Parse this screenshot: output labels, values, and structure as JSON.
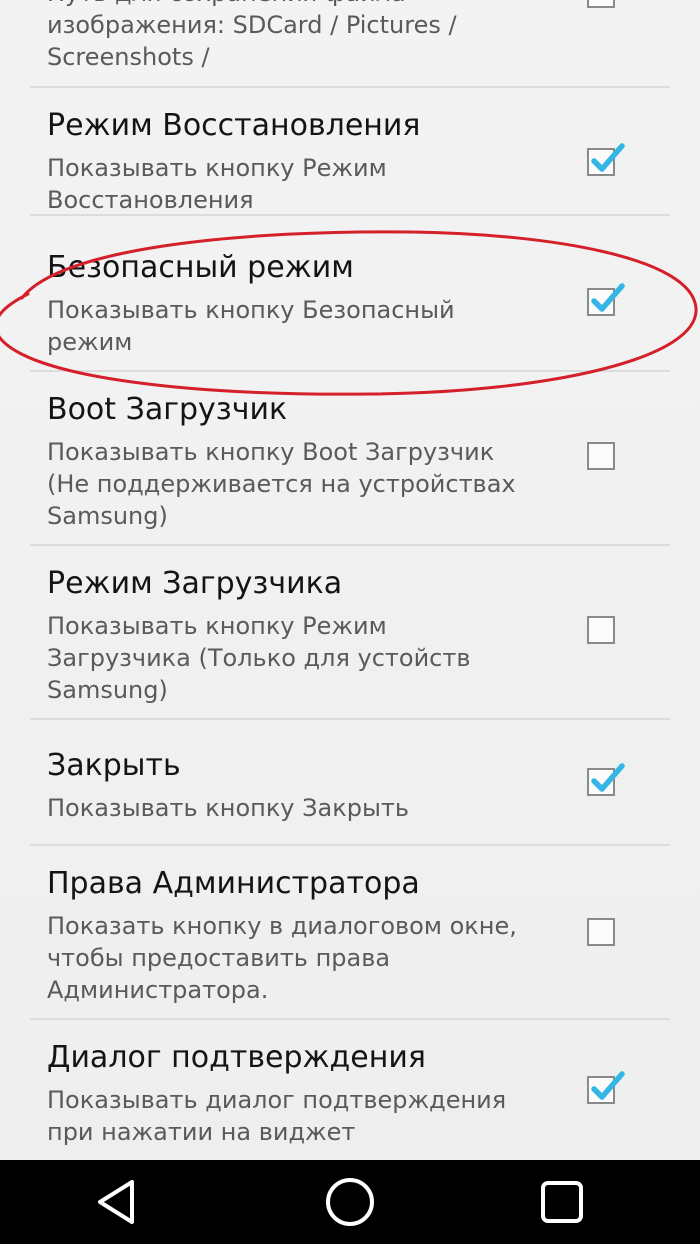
{
  "settings": {
    "items": [
      {
        "summary": "Путь для сохранения файла\nизображения: SDCard / Pictures /\nScreenshots /"
      },
      {
        "title": "Режим Восстановления",
        "summary": "Показывать кнопку Режим\nВосстановления",
        "checked": true
      },
      {
        "title": "Безопасный режим",
        "summary": "Показывать кнопку Безопасный\nрежим",
        "checked": true
      },
      {
        "title": "Boot Загрузчик",
        "summary": "Показывать кнопку Boot Загрузчик\n(Не поддерживается на устройствах\nSamsung)",
        "checked": false
      },
      {
        "title": "Режим Загрузчика",
        "summary": "Показывать кнопку Режим\nЗагрузчика (Только для устойств\nSamsung)",
        "checked": false
      },
      {
        "title": "Закрыть",
        "summary": "Показывать кнопку Закрыть",
        "checked": true
      },
      {
        "title": "Права Администратора",
        "summary": "Показать кнопку в диалоговом окне,\nчтобы предоставить права\nАдминистратора.",
        "checked": false
      },
      {
        "title": "Диалог подтверждения",
        "summary": "Показывать диалог подтверждения\nпри нажатии на виджет",
        "checked": true
      }
    ]
  },
  "colors": {
    "check_accent": "#33b5e5",
    "highlight_ellipse": "#d4202a",
    "navbar": "#000000"
  },
  "navigation": {
    "icons": [
      "back-icon",
      "home-icon",
      "recents-icon"
    ]
  }
}
